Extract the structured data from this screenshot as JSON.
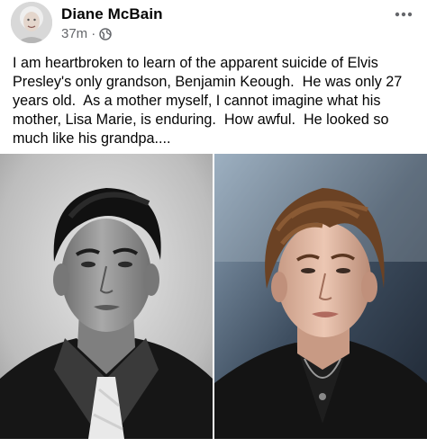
{
  "post": {
    "author": "Diane McBain",
    "timestamp": "37m",
    "separator": "·",
    "privacy_icon": "globe-icon",
    "more_icon": "ellipsis-icon",
    "text": "I am heartbroken to learn of the apparent suicide of Elvis Presley's only grandson, Benjamin Keough.  He was only 27 years old.  As a mother myself, I cannot imagine what his mother, Lisa Marie, is enduring.  How awful.  He looked so much like his grandpa....",
    "photos": [
      {
        "kind": "black-and-white portrait of a young man with a pompadour"
      },
      {
        "kind": "color photo of a young man with tousled hair in a dark shirt"
      }
    ]
  },
  "colors": {
    "text_primary": "#050505",
    "text_secondary": "#65676b",
    "background": "#ffffff"
  }
}
